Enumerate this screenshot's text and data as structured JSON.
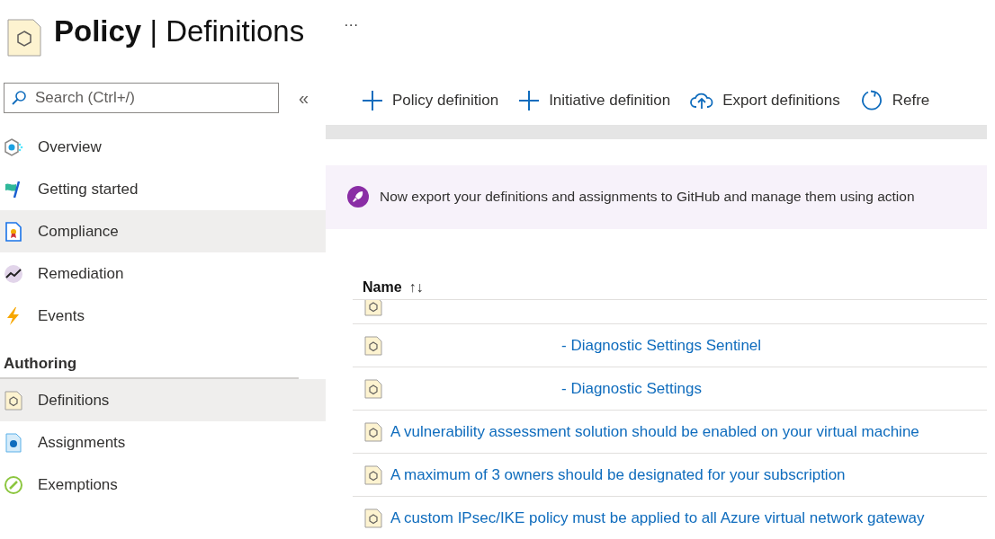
{
  "header": {
    "title_bold": "Policy",
    "separator": "|",
    "title_rest": "Definitions",
    "more": "···"
  },
  "sidebar": {
    "search": {
      "placeholder": "Search (Ctrl+/)"
    },
    "collapse": "«",
    "groups": [
      {
        "items": [
          {
            "label": "Overview",
            "kind": "overview",
            "selected": false
          },
          {
            "label": "Getting started",
            "kind": "flag",
            "selected": false
          },
          {
            "label": "Compliance",
            "kind": "compliance",
            "selected": true
          },
          {
            "label": "Remediation",
            "kind": "remediation",
            "selected": false
          },
          {
            "label": "Events",
            "kind": "events",
            "selected": false
          }
        ]
      },
      {
        "heading": "Authoring",
        "items": [
          {
            "label": "Definitions",
            "kind": "definition",
            "selected": true
          },
          {
            "label": "Assignments",
            "kind": "assignment",
            "selected": false
          },
          {
            "label": "Exemptions",
            "kind": "exemption",
            "selected": false
          }
        ]
      }
    ]
  },
  "toolbar": [
    {
      "label": "Policy definition",
      "kind": "add"
    },
    {
      "label": "Initiative definition",
      "kind": "add"
    },
    {
      "label": "Export definitions",
      "kind": "export"
    },
    {
      "label": "Refre",
      "kind": "refresh"
    }
  ],
  "banner": {
    "text": "Now export your definitions and assignments to GitHub and manage them using action"
  },
  "table": {
    "columns": [
      {
        "label": "Name",
        "sort": "↑↓"
      }
    ],
    "rows": [
      {
        "redacted": true,
        "partial": true
      },
      {
        "name": "- Diagnostic Settings Sentinel",
        "redacted": true
      },
      {
        "name": "- Diagnostic Settings",
        "redacted": true
      },
      {
        "name": "A vulnerability assessment solution should be enabled on your virtual machine",
        "redacted": false
      },
      {
        "name": "A maximum of 3 owners should be designated for your subscription",
        "redacted": false
      },
      {
        "name": "A custom IPsec/IKE policy must be applied to all Azure virtual network gateway",
        "redacted": false
      }
    ]
  }
}
